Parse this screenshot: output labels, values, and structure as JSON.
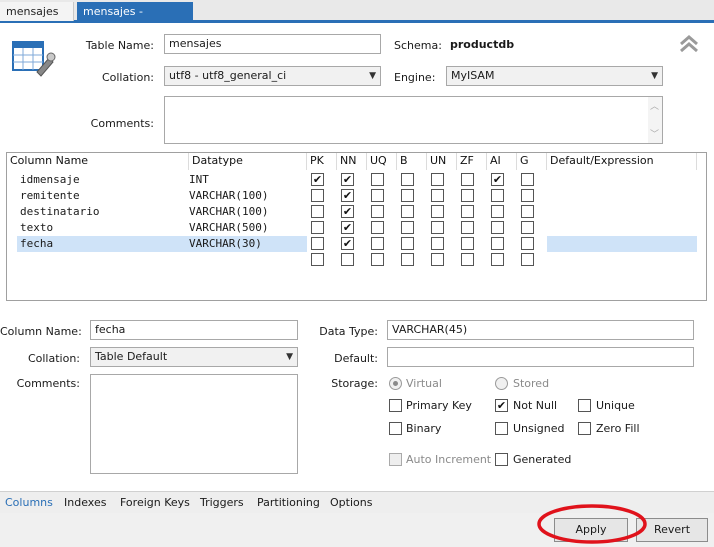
{
  "tabs": [
    {
      "label": "mensajes"
    },
    {
      "label": "mensajes - Table"
    }
  ],
  "close_glyph": "×",
  "table_form": {
    "table_name_label": "Table Name:",
    "table_name_value": "mensajes",
    "schema_label": "Schema:",
    "schema_value": "productdb",
    "collation_label": "Collation:",
    "collation_value": "utf8 - utf8_general_ci",
    "engine_label": "Engine:",
    "engine_value": "MyISAM",
    "comments_label": "Comments:",
    "comments_value": ""
  },
  "grid": {
    "headers": [
      "Column Name",
      "Datatype",
      "PK",
      "NN",
      "UQ",
      "B",
      "UN",
      "ZF",
      "AI",
      "G",
      "Default/Expression"
    ],
    "rows": [
      {
        "name": "idmensaje",
        "type": "INT",
        "flags": [
          true,
          true,
          false,
          false,
          false,
          false,
          true,
          false
        ],
        "selected": false
      },
      {
        "name": "remitente",
        "type": "VARCHAR(100)",
        "flags": [
          false,
          true,
          false,
          false,
          false,
          false,
          false,
          false
        ],
        "selected": false
      },
      {
        "name": "destinatario",
        "type": "VARCHAR(100)",
        "flags": [
          false,
          true,
          false,
          false,
          false,
          false,
          false,
          false
        ],
        "selected": false
      },
      {
        "name": "texto",
        "type": "VARCHAR(500)",
        "flags": [
          false,
          true,
          false,
          false,
          false,
          false,
          false,
          false
        ],
        "selected": false
      },
      {
        "name": "fecha",
        "type": "VARCHAR(30)",
        "flags": [
          false,
          true,
          false,
          false,
          false,
          false,
          false,
          false
        ],
        "selected": true
      },
      {
        "name": "",
        "type": "",
        "flags": [
          false,
          false,
          false,
          false,
          false,
          false,
          false,
          false
        ],
        "selected": false
      }
    ]
  },
  "column_details": {
    "column_name_label": "Column Name:",
    "column_name_value": "fecha",
    "collation_label": "Collation:",
    "collation_value": "Table Default",
    "comments_label": "Comments:",
    "data_type_label": "Data Type:",
    "data_type_value": "VARCHAR(45)",
    "default_label": "Default:",
    "default_value": "",
    "storage_label": "Storage:",
    "storage_options": [
      {
        "label": "Virtual",
        "selected": true
      },
      {
        "label": "Stored",
        "selected": false
      }
    ],
    "flags": [
      {
        "label": "Primary Key",
        "checked": false,
        "enabled": true
      },
      {
        "label": "Not Null",
        "checked": true,
        "enabled": true
      },
      {
        "label": "Unique",
        "checked": false,
        "enabled": true
      },
      {
        "label": "Binary",
        "checked": false,
        "enabled": true
      },
      {
        "label": "Unsigned",
        "checked": false,
        "enabled": true
      },
      {
        "label": "Zero Fill",
        "checked": false,
        "enabled": true
      },
      {
        "label": "Auto Increment",
        "checked": false,
        "enabled": false
      },
      {
        "label": "Generated",
        "checked": false,
        "enabled": true
      }
    ]
  },
  "bottom_tabs": [
    "Columns",
    "Indexes",
    "Foreign Keys",
    "Triggers",
    "Partitioning",
    "Options"
  ],
  "buttons": {
    "apply": "Apply",
    "revert": "Revert"
  },
  "check_glyph": "✔",
  "colors": {
    "accent": "#2a6fb6",
    "selection": "#cfe3f8",
    "annotation": "#e0121b"
  }
}
